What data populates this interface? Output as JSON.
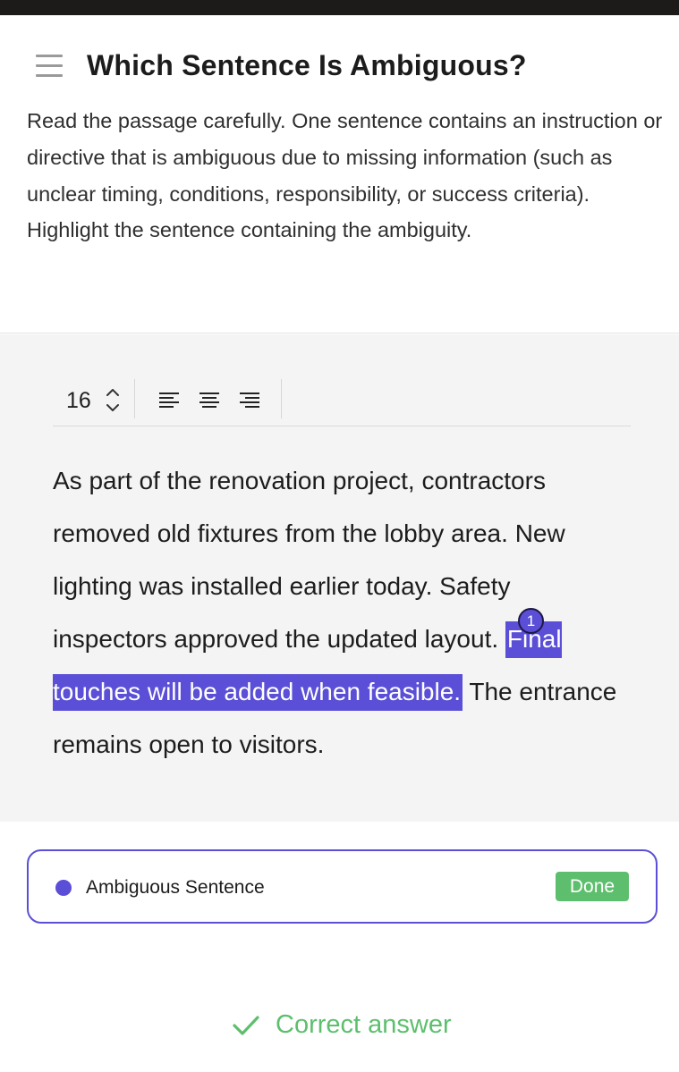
{
  "header": {
    "menu_icon": "hamburger-menu-icon",
    "title": "Which Sentence Is Ambiguous?",
    "instructions": "Read the passage carefully. One sentence contains an instruction or directive that is ambiguous due to missing information (such as unclear timing, conditions, responsibility, or success criteria). Highlight the sentence containing the ambiguity."
  },
  "toolbar": {
    "font_size": "16",
    "stepper_icon": "chevron-up-down-icon",
    "align_buttons": [
      "align-left-icon",
      "align-center-icon",
      "align-right-icon"
    ]
  },
  "passage": {
    "before": "As part of the renovation project, contractors removed old fixtures from the lobby area. New lighting was installed earlier today. Safety inspectors approved the updated layout. ",
    "highlighted": "Final touches will be added when feasible.",
    "after": " The entrance remains open to visitors.",
    "highlight_number": "1",
    "highlight_color": "#5a4fd6"
  },
  "label": {
    "name": "Ambiguous Sentence",
    "status": "Done",
    "dot_color": "#5a4fd6",
    "status_color": "#5dbf6d"
  },
  "result": {
    "icon": "checkmark-icon",
    "text": "Correct answer",
    "color": "#5dbf6d"
  }
}
